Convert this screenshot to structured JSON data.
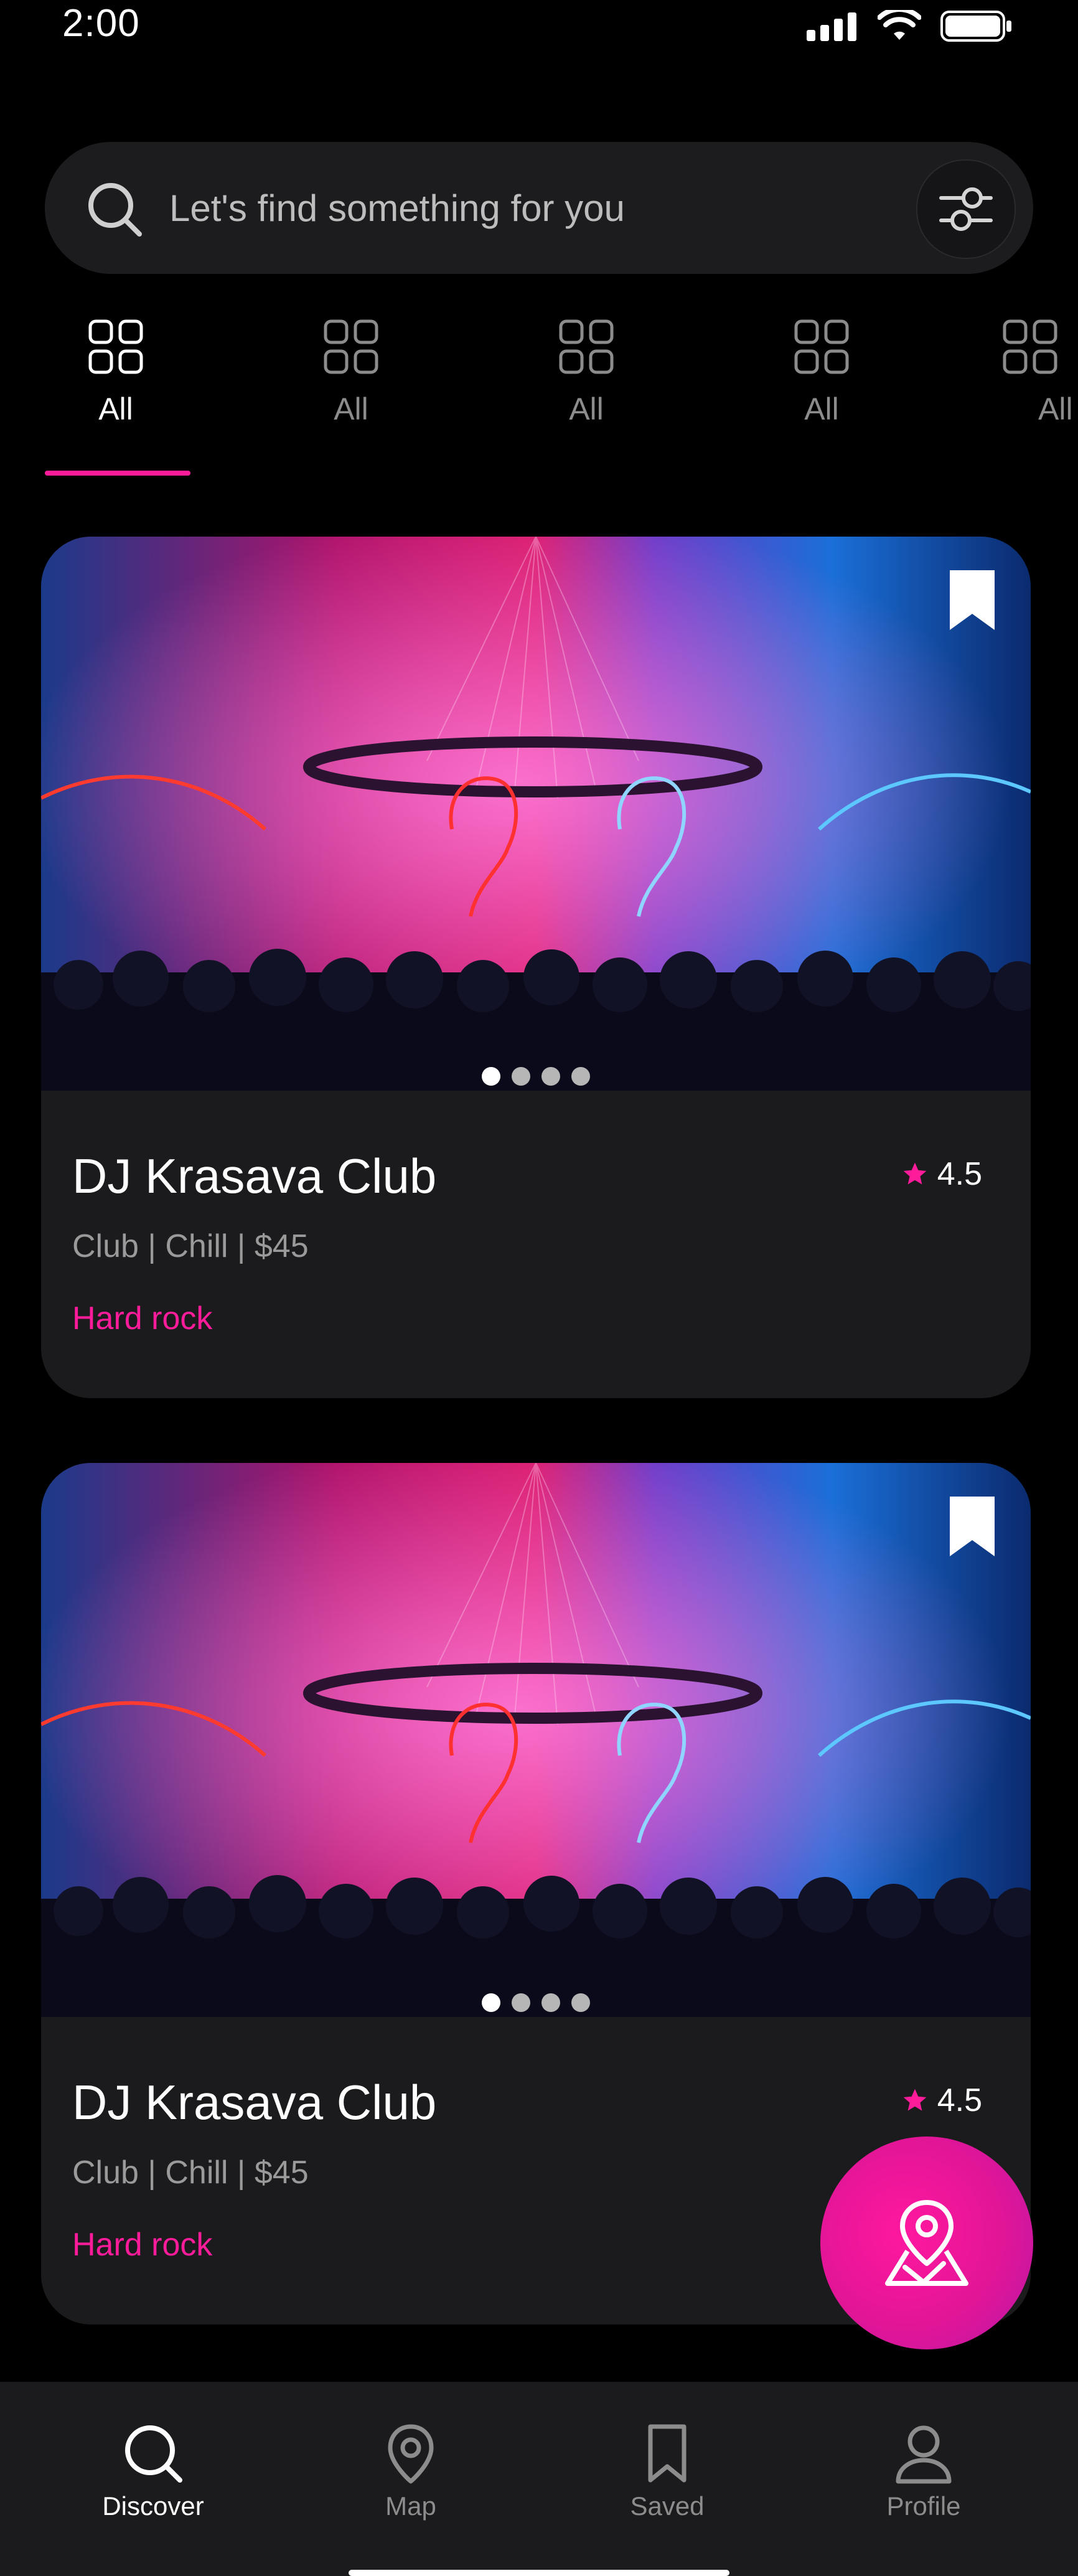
{
  "status_bar": {
    "time": "2:00"
  },
  "search": {
    "placeholder": "Let's find something for you"
  },
  "categories": [
    {
      "label": "All",
      "active": true
    },
    {
      "label": "All",
      "active": false
    },
    {
      "label": "All",
      "active": false
    },
    {
      "label": "All",
      "active": false
    },
    {
      "label": "All",
      "active": false
    }
  ],
  "cards": [
    {
      "title": "DJ Krasava Club",
      "meta": "Club | Chill | $45",
      "genre": "Hard rock",
      "rating": "4.5",
      "image_slide": 1,
      "image_slides_total": 4
    },
    {
      "title": "DJ Krasava Club",
      "meta": "Club | Chill | $45",
      "genre": "Hard rock",
      "rating": "4.5",
      "image_slide": 1,
      "image_slides_total": 4
    }
  ],
  "nav": {
    "items": [
      {
        "label": "Discover",
        "icon": "search-icon",
        "active": true
      },
      {
        "label": "Map",
        "icon": "location-pin-icon",
        "active": false
      },
      {
        "label": "Saved",
        "icon": "bookmark-icon",
        "active": false
      },
      {
        "label": "Profile",
        "icon": "user-icon",
        "active": false
      }
    ]
  },
  "colors": {
    "accent": "#ff1c9b",
    "background": "#000000",
    "surface": "#1b1b1d"
  }
}
